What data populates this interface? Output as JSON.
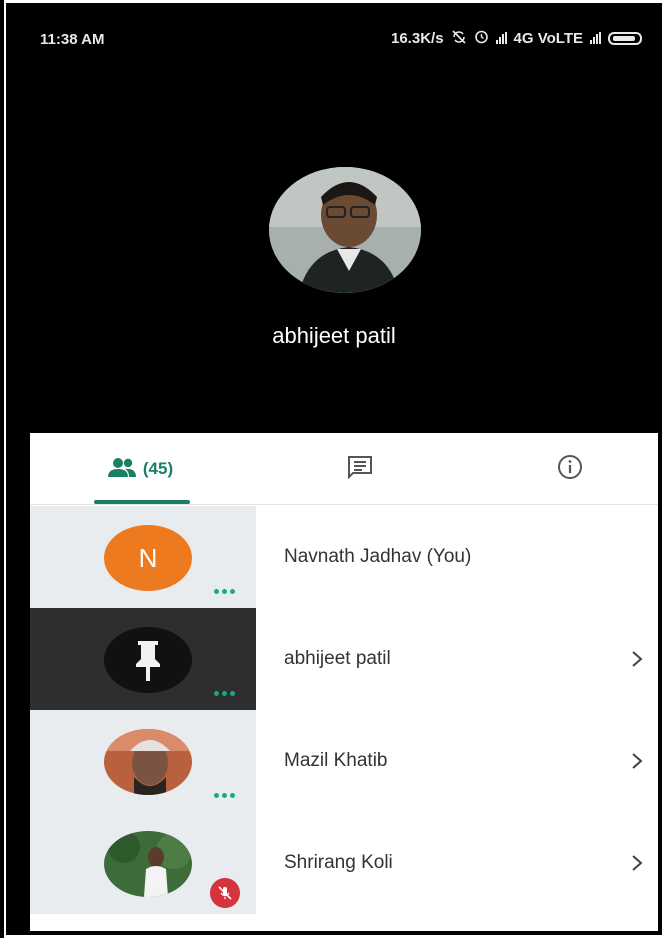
{
  "status_bar": {
    "time": "11:38 AM",
    "speed": "16.3K/s",
    "network": "4G VoLTE",
    "icons": [
      "sync-off-icon",
      "alarm-icon",
      "signal-icon",
      "battery-icon"
    ]
  },
  "call": {
    "caller_name": "abhijeet patil"
  },
  "tabs": {
    "people_count": "(45)",
    "items": [
      "people-icon",
      "chat-icon",
      "info-icon"
    ]
  },
  "participants": [
    {
      "name": "Navnath Jadhav (You)",
      "avatar_letter": "N",
      "status": "dots",
      "chevron": false,
      "selected": false
    },
    {
      "name": "abhijeet patil",
      "status": "dots",
      "chevron": true,
      "selected": true,
      "avatar_icon": "pin-icon"
    },
    {
      "name": "Mazil Khatib",
      "status": "dots",
      "chevron": true,
      "selected": false
    },
    {
      "name": "Shrirang Koli",
      "status": "muted",
      "chevron": true,
      "selected": false
    }
  ],
  "colors": {
    "accent": "#1a7f64",
    "dots": "#1ba88a",
    "mute": "#d3343d",
    "avatar_orange": "#ee7a1f"
  }
}
